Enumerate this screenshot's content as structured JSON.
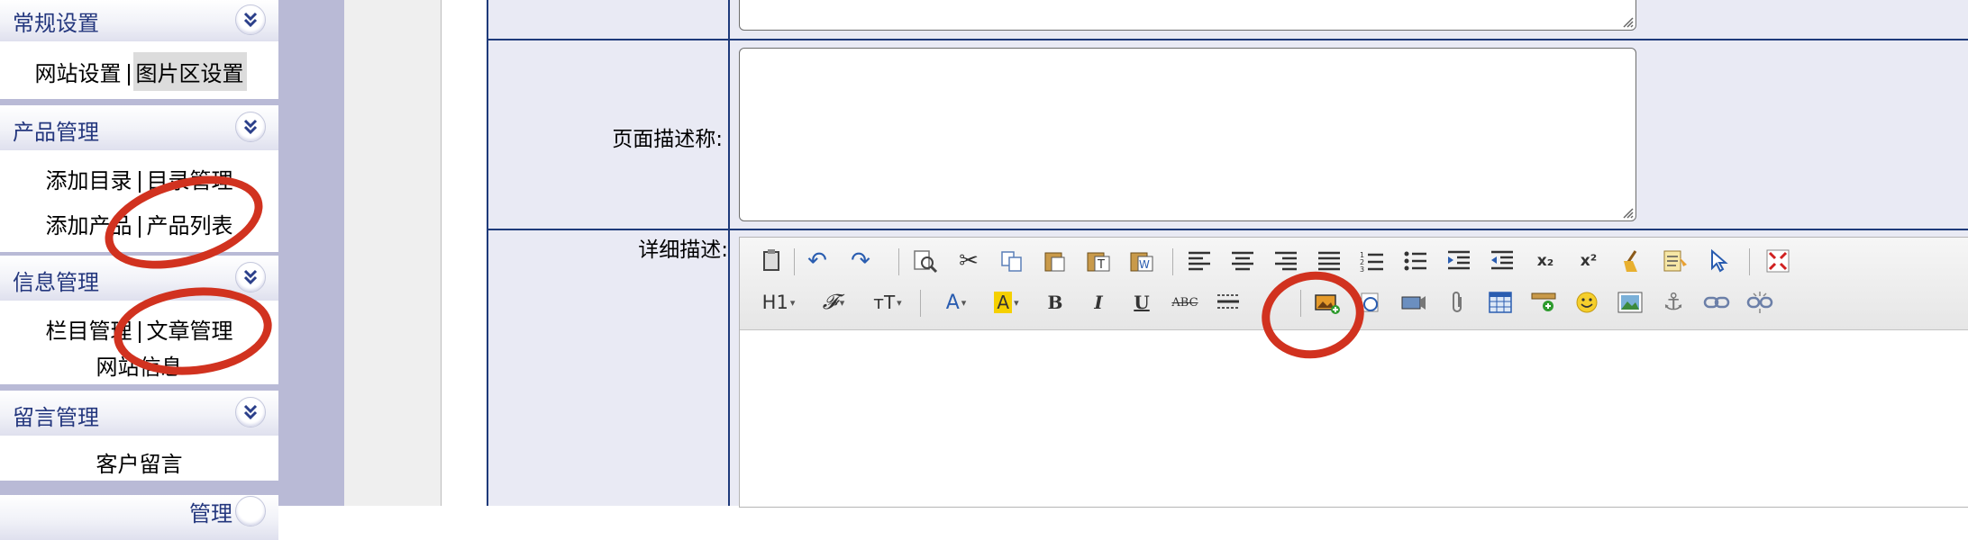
{
  "sidebar": {
    "panels": [
      {
        "title": "常规设置",
        "links": [
          [
            "网站设置",
            "图片区设置"
          ]
        ]
      },
      {
        "title": "产品管理",
        "links": [
          [
            "添加目录",
            "目录管理"
          ],
          [
            "添加产品",
            "产品列表"
          ]
        ]
      },
      {
        "title": "信息管理",
        "links": [
          [
            "栏目管理",
            "文章管理"
          ],
          [
            "网站信息"
          ]
        ]
      },
      {
        "title": "留言管理",
        "links": [
          [
            "客户留言"
          ]
        ]
      },
      {
        "title": "管理"
      }
    ]
  },
  "form": {
    "page_desc_label": "页面描述称:",
    "detail_label": "详细描述:"
  },
  "editor": {
    "row1_icons": [
      "source-icon",
      "undo-icon",
      "redo-icon",
      "preview-icon",
      "cut-icon",
      "copy-icon",
      "paste-icon",
      "paste-text-icon",
      "paste-word-icon",
      "align-left-icon",
      "align-center-icon",
      "align-right-icon",
      "align-justify-icon",
      "ordered-list-icon",
      "unordered-list-icon",
      "indent-icon",
      "outdent-icon",
      "subscript-icon",
      "superscript-icon",
      "clear-format-icon",
      "select-all-icon",
      "select-icon",
      "fullscreen-icon"
    ],
    "row2_icons": [
      "heading-icon",
      "font-family-icon",
      "font-size-icon",
      "font-color-icon",
      "highlight-icon",
      "bold-icon",
      "italic-icon",
      "underline-icon",
      "strikethrough-icon",
      "horizontal-rule-icon",
      "remove-format-icon",
      "insert-image-icon",
      "flash-icon",
      "media-icon",
      "attachment-icon",
      "table-icon",
      "insert-line-icon",
      "emoticon-icon",
      "image-manager-icon",
      "anchor-icon",
      "link-icon",
      "unlink-icon"
    ],
    "labels": {
      "heading": "H1",
      "font_family": "𝓕",
      "font_size": "тT",
      "font_color": "A",
      "highlight": "A",
      "bold": "B",
      "italic": "I",
      "underline": "U",
      "strikethrough": "ABC",
      "subscript": "x₂",
      "superscript": "x²"
    }
  },
  "colors": {
    "sidebar_bg": "#b9bad6",
    "panel_title": "#24377e",
    "form_bg": "#e9eaf4",
    "table_border": "#1e3a7a",
    "annotation_red": "#d1321f"
  }
}
